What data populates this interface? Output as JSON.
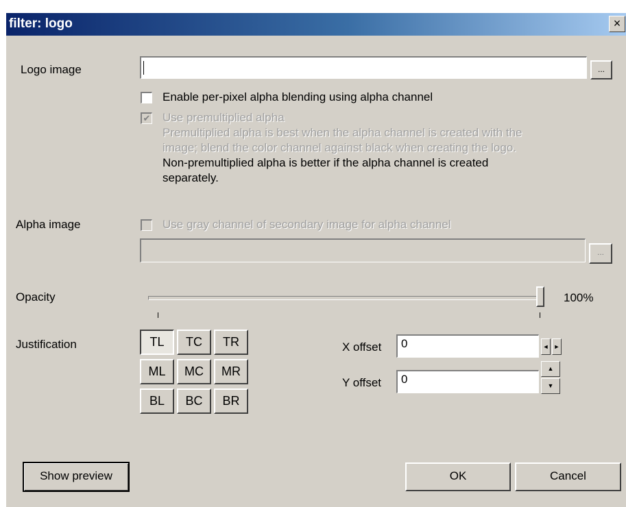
{
  "window": {
    "title": "filter: logo",
    "close_glyph": "×"
  },
  "logo_image": {
    "label": "Logo image",
    "value": "",
    "browse_label": "..."
  },
  "alpha_blend": {
    "checkbox_label": "Enable per-pixel alpha blending using alpha channel",
    "checked": false
  },
  "premultiplied": {
    "checkbox_label": "Use premultiplied alpha",
    "checked": true,
    "enabled": false,
    "help_line1": "Premultiplied alpha is best when the alpha channel is created with the",
    "help_line2": "image; blend the color channel against black when creating the logo.",
    "note_line1": "Non-premultiplied alpha is better if the alpha channel is created",
    "note_line2": "separately."
  },
  "alpha_image": {
    "label": "Alpha image",
    "checkbox_label": "Use gray channel of secondary image for alpha channel",
    "checked": false,
    "enabled": false,
    "value": "",
    "browse_label": "..."
  },
  "opacity": {
    "label": "Opacity",
    "value_text": "100%",
    "value": 1.0
  },
  "justification": {
    "label": "Justification",
    "selected": "TL",
    "rows": [
      [
        "TL",
        "TC",
        "TR"
      ],
      [
        "ML",
        "MC",
        "MR"
      ],
      [
        "BL",
        "BC",
        "BR"
      ]
    ]
  },
  "x_offset": {
    "label": "X offset",
    "value": "0"
  },
  "y_offset": {
    "label": "Y offset",
    "value": "0"
  },
  "buttons": {
    "preview": "Show preview",
    "ok": "OK",
    "cancel": "Cancel"
  },
  "icons": {
    "spin_left": "◄",
    "spin_right": "►",
    "spin_up": "▲",
    "spin_down": "▼"
  },
  "colors": {
    "title_start": "#0a246a",
    "title_end": "#a6caf0",
    "face": "#d4d0c8"
  }
}
